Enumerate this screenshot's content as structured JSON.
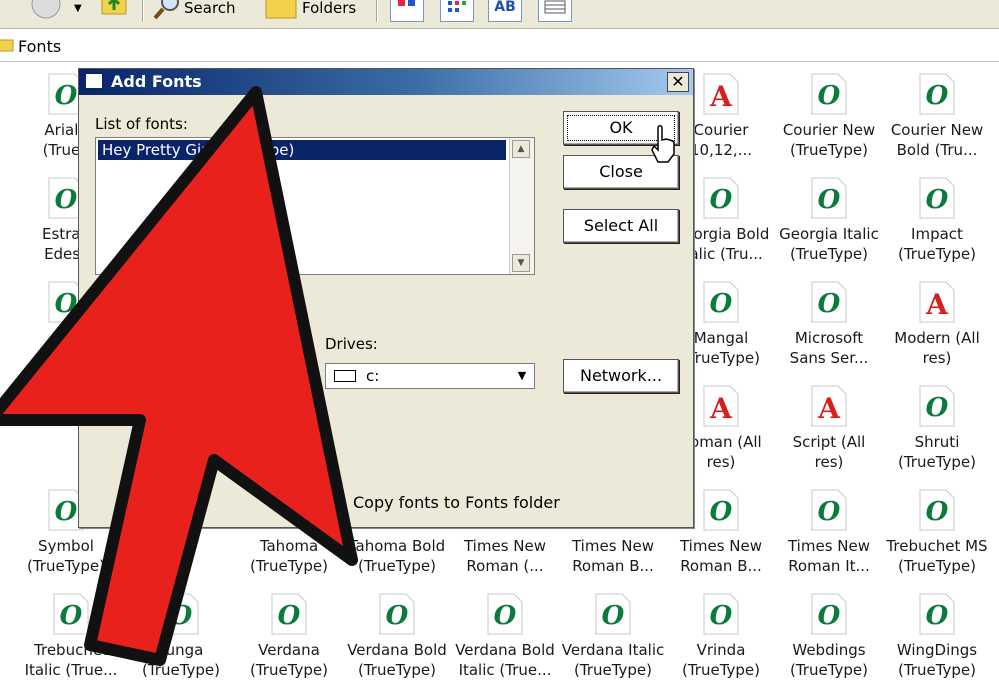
{
  "toolbar": {
    "search_label": "Search",
    "folders_label": "Folders",
    "view_ab_label": "AB"
  },
  "address": {
    "path": "Fonts"
  },
  "dialog": {
    "title": "Add Fonts",
    "close_glyph": "✕",
    "list_label": "List of fonts:",
    "selected_font": "Hey Pretty Girl (TrueType)",
    "drives_label": "Drives:",
    "drive_value": "c:",
    "ok_label": "OK",
    "close_label": "Close",
    "select_all_label": "Select All",
    "network_label": "Network...",
    "copy_label": "Copy fonts to Fonts folder"
  },
  "fonts": {
    "r1c0": "Arial I\n(TrueT",
    "r1c6": "Courier\n10,12,...",
    "r1c7": "Courier New\n(TrueType)",
    "r1c8": "Courier New\nBold (Tru...",
    "r2c0": "Estran\nEdess",
    "r2c6": "Georgia Bold\nItalic (Tru...",
    "r2c7": "Georgia Italic\n(TrueType)",
    "r2c8": "Impact\n(TrueType)",
    "r3c6": "Mangal\n(TrueType)",
    "r3c7": "Microsoft\nSans Ser...",
    "r3c8": "Modern (All\nres)",
    "r4c6": "Roman (All\nres)",
    "r4c7": "Script (All\nres)",
    "r4c8": "Shruti\n(TrueType)",
    "r5c0": "Symbol\n(TrueType)",
    "r5c2": "Tahoma\n(TrueType)",
    "r5c3": "Tahoma Bold\n(TrueType)",
    "r5c4": "Times New\nRoman (...",
    "r5c5": "Times New\nRoman B...",
    "r5c6": "Times New\nRoman B...",
    "r5c7": "Times New\nRoman It...",
    "r5c8": "Trebuchet MS\n(TrueType)",
    "r6c0": "Trebuchet\nItalic (True...",
    "r6c1": "Tunga\n(TrueType)",
    "r6c2": "Verdana\n(TrueType)",
    "r6c3": "Verdana Bold\n(TrueType)",
    "r6c4": "Verdana Bold\nItalic (True...",
    "r6c5": "Verdana Italic\n(TrueType)",
    "r6c6": "Vrinda\n(TrueType)",
    "r6c7": "Webdings\n(TrueType)",
    "r6c8": "WingDings\n(TrueType)"
  },
  "colors": {
    "truetype_green": "#0b7a3b",
    "raster_red": "#d62020",
    "arrow_red": "#e8211d",
    "selection": "#0a246a"
  }
}
